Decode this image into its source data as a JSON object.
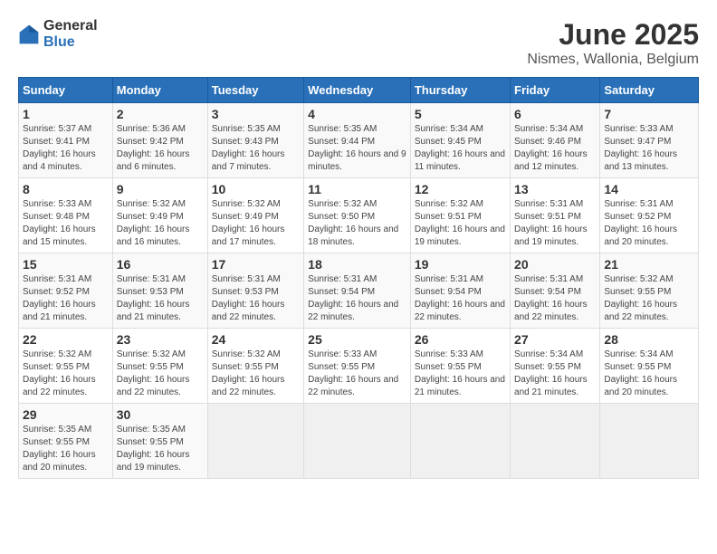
{
  "logo": {
    "text_general": "General",
    "text_blue": "Blue"
  },
  "title": "June 2025",
  "subtitle": "Nismes, Wallonia, Belgium",
  "days_header": [
    "Sunday",
    "Monday",
    "Tuesday",
    "Wednesday",
    "Thursday",
    "Friday",
    "Saturday"
  ],
  "weeks": [
    [
      {
        "num": "1",
        "sunrise": "Sunrise: 5:37 AM",
        "sunset": "Sunset: 9:41 PM",
        "daylight": "Daylight: 16 hours and 4 minutes."
      },
      {
        "num": "2",
        "sunrise": "Sunrise: 5:36 AM",
        "sunset": "Sunset: 9:42 PM",
        "daylight": "Daylight: 16 hours and 6 minutes."
      },
      {
        "num": "3",
        "sunrise": "Sunrise: 5:35 AM",
        "sunset": "Sunset: 9:43 PM",
        "daylight": "Daylight: 16 hours and 7 minutes."
      },
      {
        "num": "4",
        "sunrise": "Sunrise: 5:35 AM",
        "sunset": "Sunset: 9:44 PM",
        "daylight": "Daylight: 16 hours and 9 minutes."
      },
      {
        "num": "5",
        "sunrise": "Sunrise: 5:34 AM",
        "sunset": "Sunset: 9:45 PM",
        "daylight": "Daylight: 16 hours and 11 minutes."
      },
      {
        "num": "6",
        "sunrise": "Sunrise: 5:34 AM",
        "sunset": "Sunset: 9:46 PM",
        "daylight": "Daylight: 16 hours and 12 minutes."
      },
      {
        "num": "7",
        "sunrise": "Sunrise: 5:33 AM",
        "sunset": "Sunset: 9:47 PM",
        "daylight": "Daylight: 16 hours and 13 minutes."
      }
    ],
    [
      {
        "num": "8",
        "sunrise": "Sunrise: 5:33 AM",
        "sunset": "Sunset: 9:48 PM",
        "daylight": "Daylight: 16 hours and 15 minutes."
      },
      {
        "num": "9",
        "sunrise": "Sunrise: 5:32 AM",
        "sunset": "Sunset: 9:49 PM",
        "daylight": "Daylight: 16 hours and 16 minutes."
      },
      {
        "num": "10",
        "sunrise": "Sunrise: 5:32 AM",
        "sunset": "Sunset: 9:49 PM",
        "daylight": "Daylight: 16 hours and 17 minutes."
      },
      {
        "num": "11",
        "sunrise": "Sunrise: 5:32 AM",
        "sunset": "Sunset: 9:50 PM",
        "daylight": "Daylight: 16 hours and 18 minutes."
      },
      {
        "num": "12",
        "sunrise": "Sunrise: 5:32 AM",
        "sunset": "Sunset: 9:51 PM",
        "daylight": "Daylight: 16 hours and 19 minutes."
      },
      {
        "num": "13",
        "sunrise": "Sunrise: 5:31 AM",
        "sunset": "Sunset: 9:51 PM",
        "daylight": "Daylight: 16 hours and 19 minutes."
      },
      {
        "num": "14",
        "sunrise": "Sunrise: 5:31 AM",
        "sunset": "Sunset: 9:52 PM",
        "daylight": "Daylight: 16 hours and 20 minutes."
      }
    ],
    [
      {
        "num": "15",
        "sunrise": "Sunrise: 5:31 AM",
        "sunset": "Sunset: 9:52 PM",
        "daylight": "Daylight: 16 hours and 21 minutes."
      },
      {
        "num": "16",
        "sunrise": "Sunrise: 5:31 AM",
        "sunset": "Sunset: 9:53 PM",
        "daylight": "Daylight: 16 hours and 21 minutes."
      },
      {
        "num": "17",
        "sunrise": "Sunrise: 5:31 AM",
        "sunset": "Sunset: 9:53 PM",
        "daylight": "Daylight: 16 hours and 22 minutes."
      },
      {
        "num": "18",
        "sunrise": "Sunrise: 5:31 AM",
        "sunset": "Sunset: 9:54 PM",
        "daylight": "Daylight: 16 hours and 22 minutes."
      },
      {
        "num": "19",
        "sunrise": "Sunrise: 5:31 AM",
        "sunset": "Sunset: 9:54 PM",
        "daylight": "Daylight: 16 hours and 22 minutes."
      },
      {
        "num": "20",
        "sunrise": "Sunrise: 5:31 AM",
        "sunset": "Sunset: 9:54 PM",
        "daylight": "Daylight: 16 hours and 22 minutes."
      },
      {
        "num": "21",
        "sunrise": "Sunrise: 5:32 AM",
        "sunset": "Sunset: 9:55 PM",
        "daylight": "Daylight: 16 hours and 22 minutes."
      }
    ],
    [
      {
        "num": "22",
        "sunrise": "Sunrise: 5:32 AM",
        "sunset": "Sunset: 9:55 PM",
        "daylight": "Daylight: 16 hours and 22 minutes."
      },
      {
        "num": "23",
        "sunrise": "Sunrise: 5:32 AM",
        "sunset": "Sunset: 9:55 PM",
        "daylight": "Daylight: 16 hours and 22 minutes."
      },
      {
        "num": "24",
        "sunrise": "Sunrise: 5:32 AM",
        "sunset": "Sunset: 9:55 PM",
        "daylight": "Daylight: 16 hours and 22 minutes."
      },
      {
        "num": "25",
        "sunrise": "Sunrise: 5:33 AM",
        "sunset": "Sunset: 9:55 PM",
        "daylight": "Daylight: 16 hours and 22 minutes."
      },
      {
        "num": "26",
        "sunrise": "Sunrise: 5:33 AM",
        "sunset": "Sunset: 9:55 PM",
        "daylight": "Daylight: 16 hours and 21 minutes."
      },
      {
        "num": "27",
        "sunrise": "Sunrise: 5:34 AM",
        "sunset": "Sunset: 9:55 PM",
        "daylight": "Daylight: 16 hours and 21 minutes."
      },
      {
        "num": "28",
        "sunrise": "Sunrise: 5:34 AM",
        "sunset": "Sunset: 9:55 PM",
        "daylight": "Daylight: 16 hours and 20 minutes."
      }
    ],
    [
      {
        "num": "29",
        "sunrise": "Sunrise: 5:35 AM",
        "sunset": "Sunset: 9:55 PM",
        "daylight": "Daylight: 16 hours and 20 minutes."
      },
      {
        "num": "30",
        "sunrise": "Sunrise: 5:35 AM",
        "sunset": "Sunset: 9:55 PM",
        "daylight": "Daylight: 16 hours and 19 minutes."
      },
      null,
      null,
      null,
      null,
      null
    ]
  ]
}
